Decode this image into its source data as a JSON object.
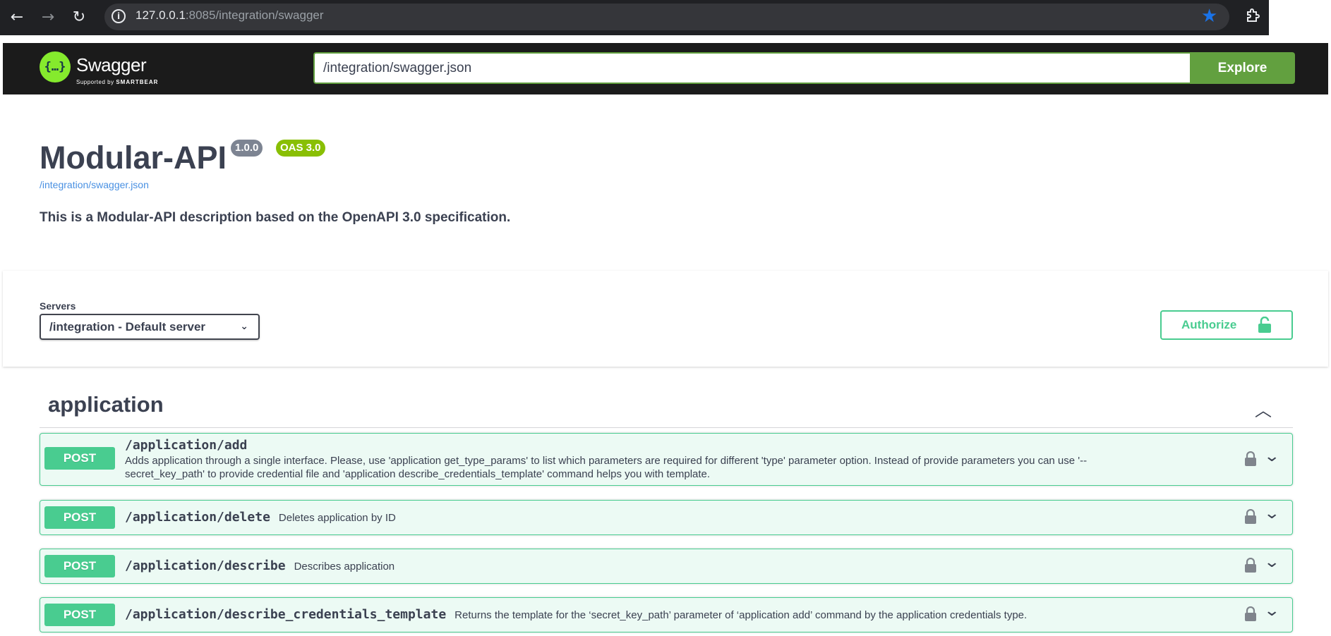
{
  "browser": {
    "url_host": "127.0.0.1",
    "url_rest": ":8085/integration/swagger",
    "back_icon": "arrow-left-icon",
    "forward_icon": "arrow-right-icon",
    "reload_icon": "reload-icon",
    "info_icon": "info-icon",
    "bookmark_icon": "star-icon",
    "extensions_icon": "puzzle-icon",
    "accent_color": "#1a73e8"
  },
  "topbar": {
    "logo_text": "Swagger",
    "logo_supported": "Supported by",
    "logo_brand": "SMARTBEAR",
    "spec_url_value": "/integration/swagger.json",
    "explore_label": "Explore",
    "brand_color": "#85ea2d",
    "explore_color": "#62a03f"
  },
  "info": {
    "title": "Modular-API",
    "version": "1.0.0",
    "oas": "OAS 3.0",
    "spec_link": "/integration/swagger.json",
    "description": "This is a Modular-API description based on the OpenAPI 3.0 specification."
  },
  "scheme": {
    "servers_label": "Servers",
    "selected_server": "/integration - Default server",
    "authorize_label": "Authorize"
  },
  "tag": {
    "name": "application",
    "expanded": true
  },
  "operations": [
    {
      "method": "POST",
      "path": "/application/add",
      "summary_line1": "Adds application through a single interface. Please, use 'application get_type_params' to list which parameters are required for different 'type' parameter option. Instead of provide parameters you can use '--",
      "summary_line2": "secret_key_path' to provide credential file and 'application describe_credentials_template' command helps you with template."
    },
    {
      "method": "POST",
      "path": "/application/delete",
      "summary": "Deletes application by ID"
    },
    {
      "method": "POST",
      "path": "/application/describe",
      "summary": "Describes application"
    },
    {
      "method": "POST",
      "path": "/application/describe_credentials_template",
      "summary": "Returns the template for the ‘secret_key_path’ parameter of ‘application add’ command by the application credentials type."
    }
  ],
  "post_color": "#49cc90"
}
